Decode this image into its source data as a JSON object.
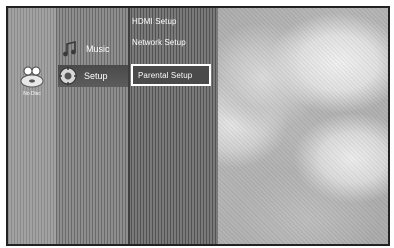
{
  "disc_status": {
    "label": "No Disc"
  },
  "main_menu": {
    "items": [
      {
        "label": "Music",
        "icon": "music-icon"
      },
      {
        "label": "Setup",
        "icon": "setup-gear-icon",
        "selected": true
      }
    ]
  },
  "setup_submenu": {
    "items": [
      {
        "label": "HDMI Setup"
      },
      {
        "label": "Network Setup"
      },
      {
        "label": "Parental Setup",
        "selected": true
      }
    ]
  }
}
